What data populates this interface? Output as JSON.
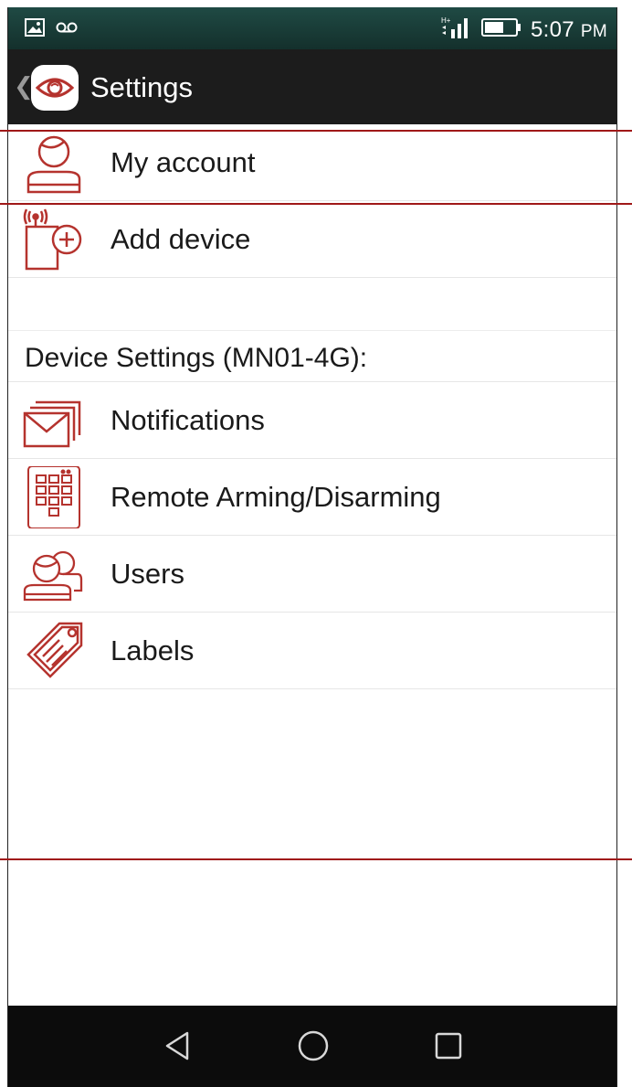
{
  "status_bar": {
    "time": "5:07",
    "ampm": "PM",
    "left_icons": [
      "image-notification-icon",
      "voicemail-icon"
    ],
    "right_icons": [
      "signal-icon",
      "battery-icon"
    ]
  },
  "action_bar": {
    "title": "Settings",
    "back_icon": "chevron-left-icon",
    "logo_icon": "eye-logo-icon"
  },
  "account_items": [
    {
      "label": "My account",
      "icon": "account-icon"
    },
    {
      "label": "Add device",
      "icon": "add-device-icon"
    }
  ],
  "device_section": {
    "header": "Device Settings (MN01-4G):",
    "items": [
      {
        "label": "Notifications",
        "icon": "envelope-icon"
      },
      {
        "label": "Remote Arming/Disarming",
        "icon": "keypad-icon"
      },
      {
        "label": "Users",
        "icon": "users-icon"
      },
      {
        "label": "Labels",
        "icon": "tag-icon"
      }
    ]
  },
  "nav_bar": {
    "icons": [
      "back-triangle-icon",
      "home-circle-icon",
      "recents-square-icon"
    ]
  },
  "colors": {
    "status_bar": "#1f4a44",
    "action_bar": "#1c1c1c",
    "icon_red": "#b5332e",
    "annotation_red": "#a01818",
    "nav_bar": "#0c0c0c"
  }
}
